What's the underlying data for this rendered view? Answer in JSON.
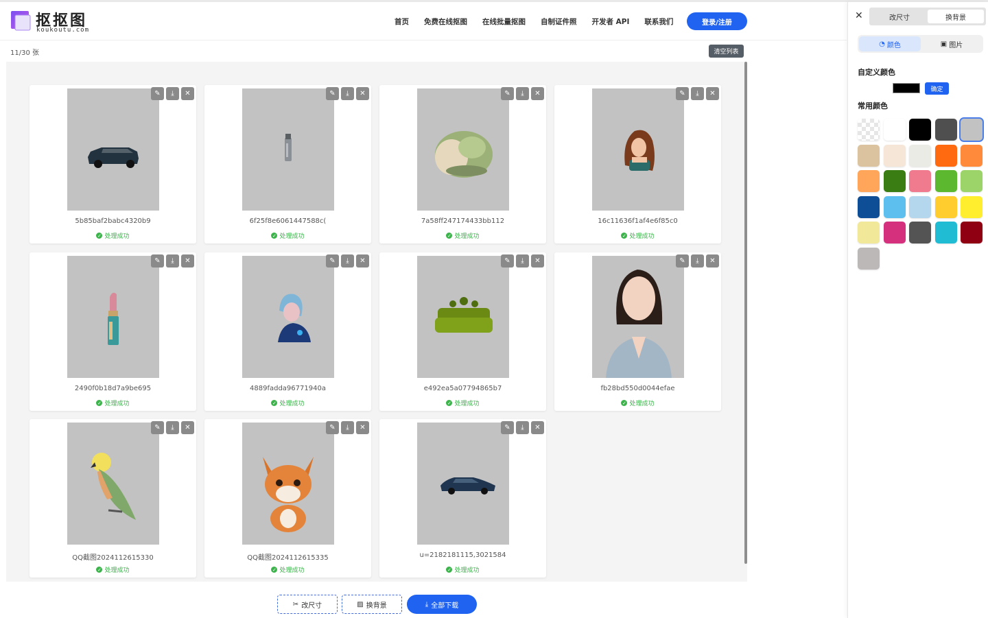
{
  "header": {
    "logo_text": "抠抠图",
    "logo_sub": "koukoutu.com",
    "nav": [
      "首页",
      "免费在线抠图",
      "在线批量抠图",
      "自制证件照",
      "开发者 API",
      "联系我们"
    ],
    "login_label": "登录/注册"
  },
  "main": {
    "count_label": "11/30 张",
    "clear_label": "清空列表",
    "status_label": "处理成功",
    "cards": [
      {
        "name": "5b85baf2babc4320b9",
        "subject": "suv-car"
      },
      {
        "name": "6f25f8e6061447588c(",
        "subject": "bottle"
      },
      {
        "name": "7a58ff247174433bb112",
        "subject": "armchair"
      },
      {
        "name": "16c11636f1af4e6f85c0",
        "subject": "woman-portrait"
      },
      {
        "name": "2490f0b18d7a9be695",
        "subject": "lipstick"
      },
      {
        "name": "4889fadda96771940a",
        "subject": "cyber-girl"
      },
      {
        "name": "e492ea5a07794865b7",
        "subject": "moss-sofa"
      },
      {
        "name": "fb28bd550d0044efae",
        "subject": "business-woman"
      },
      {
        "name": "QQ截图2024112615330",
        "subject": "parrot"
      },
      {
        "name": "QQ截图2024112615335",
        "subject": "fox"
      },
      {
        "name": "u=2182181115,3021584",
        "subject": "sedan-car"
      }
    ]
  },
  "toolbar": {
    "resize_label": "改尺寸",
    "bg_label": "换背景",
    "download_label": "全部下载"
  },
  "panel": {
    "tab_resize": "改尺寸",
    "tab_bg": "换背景",
    "subtab_color": "颜色",
    "subtab_image": "图片",
    "custom_color_title": "自定义颜色",
    "custom_color_value": "#000000",
    "confirm_label": "确定",
    "common_color_title": "常用颜色",
    "selected_color": "#c2c2c2",
    "colors": [
      "transparent",
      "#ffffff",
      "#000000",
      "#4f4f4f",
      "#c2c2c2",
      "#dcc3a0",
      "#f5e6d8",
      "#ebebe6",
      "#ff6a10",
      "#ff8a3c",
      "#ffa65a",
      "#3a7d12",
      "#f07a8e",
      "#5cb82e",
      "#9cd46a",
      "#0e4e96",
      "#5cbfee",
      "#b4d7ee",
      "#ffce2e",
      "#ffee2e",
      "#f2e89a",
      "#d4307e",
      "#545454",
      "#1fbcd4",
      "#8e0012",
      "#bcb8b8"
    ]
  }
}
